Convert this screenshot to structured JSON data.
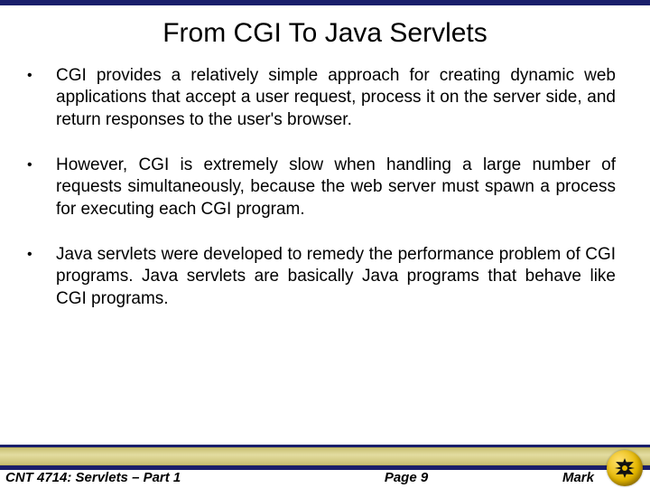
{
  "title": "From CGI To Java Servlets",
  "bullets": [
    "CGI provides a relatively simple approach for creating dynamic web applications that accept a user request, process it on the server side, and return responses to the user's browser.",
    "However, CGI is extremely slow when handling a large number of requests simultaneously, because the web server must spawn a process for executing each CGI program.",
    "Java servlets were developed to remedy the performance problem of CGI programs.  Java servlets are basically Java programs that behave like CGI programs."
  ],
  "footer": {
    "left": "CNT 4714: Servlets – Part 1",
    "center": "Page 9",
    "right": "Mark"
  }
}
